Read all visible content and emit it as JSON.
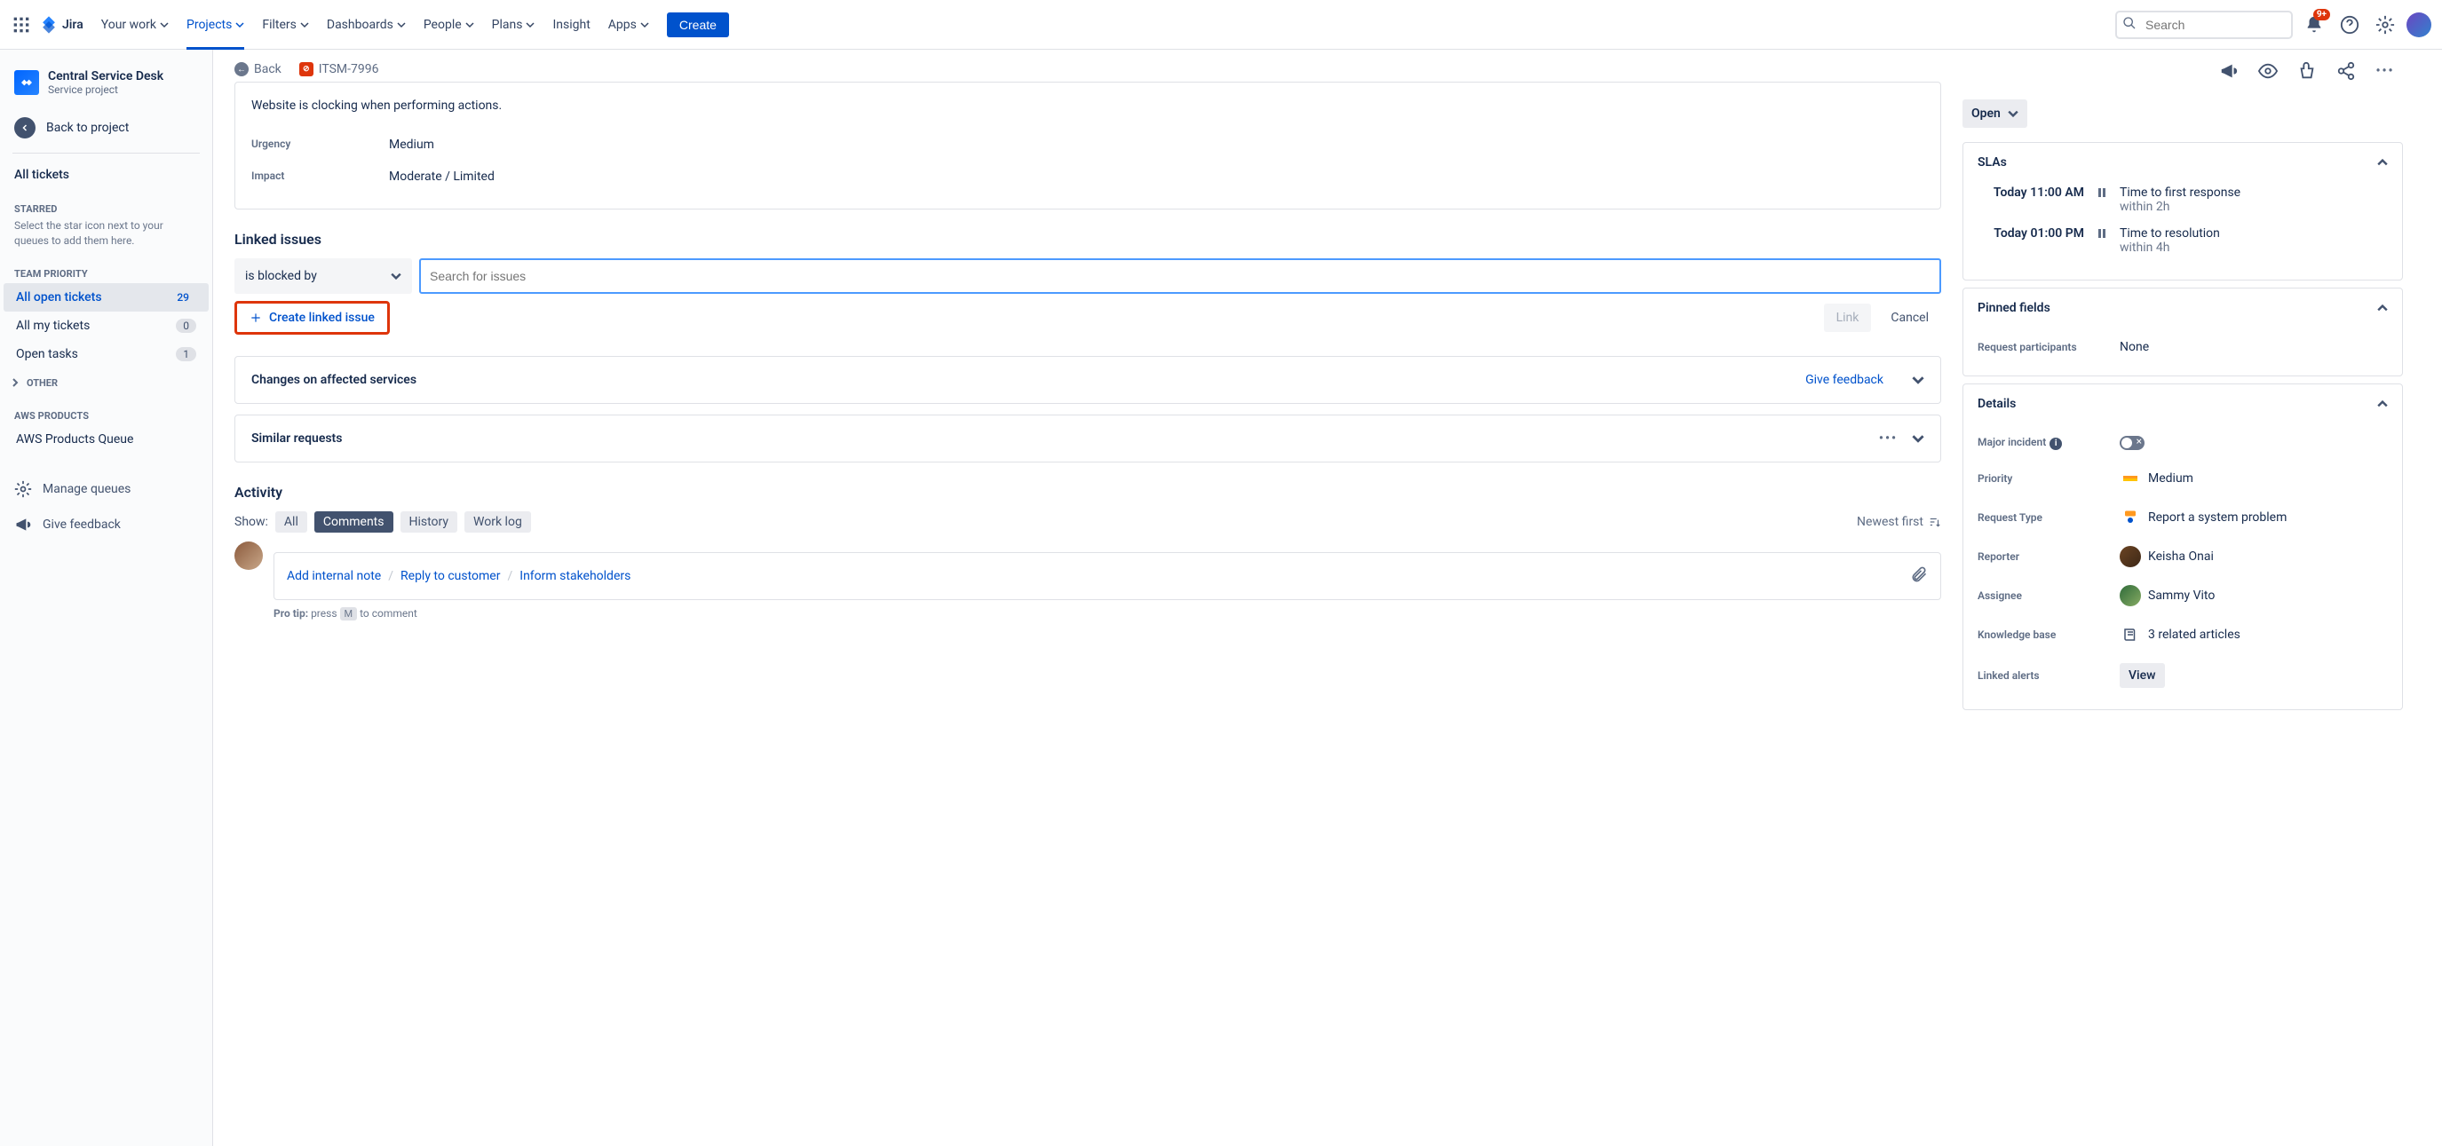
{
  "nav": {
    "brand": "Jira",
    "items": [
      "Your work",
      "Projects",
      "Filters",
      "Dashboards",
      "People",
      "Plans",
      "Insight",
      "Apps"
    ],
    "create": "Create",
    "searchPlaceholder": "Search",
    "notifBadge": "9+"
  },
  "sidebar": {
    "projectName": "Central Service Desk",
    "projectType": "Service project",
    "backToProject": "Back to project",
    "allTickets": "All tickets",
    "starredLabel": "STARRED",
    "starredDesc": "Select the star icon next to your queues to add them here.",
    "teamPriorityLabel": "TEAM PRIORITY",
    "queues": [
      {
        "name": "All open tickets",
        "count": "29"
      },
      {
        "name": "All my tickets",
        "count": "0"
      },
      {
        "name": "Open tasks",
        "count": "1"
      }
    ],
    "otherLabel": "OTHER",
    "awsLabel": "AWS PRODUCTS",
    "awsQueue": "AWS Products Queue",
    "manageQueues": "Manage queues",
    "giveFeedback": "Give feedback"
  },
  "breadcrumb": {
    "back": "Back",
    "issueKey": "ITSM-7996"
  },
  "mainPanel": {
    "description": "Website is clocking when performing actions.",
    "urgencyLabel": "Urgency",
    "urgencyValue": "Medium",
    "impactLabel": "Impact",
    "impactValue": "Moderate / Limited"
  },
  "linked": {
    "title": "Linked issues",
    "typeSelected": "is blocked by",
    "searchPlaceholder": "Search for issues",
    "createLinked": "Create linked issue",
    "linkBtn": "Link",
    "cancelBtn": "Cancel"
  },
  "changesPanel": {
    "title": "Changes on affected services",
    "feedback": "Give feedback"
  },
  "similarPanel": {
    "title": "Similar requests"
  },
  "activity": {
    "title": "Activity",
    "showLabel": "Show:",
    "tabs": [
      "All",
      "Comments",
      "History",
      "Work log"
    ],
    "newestFirst": "Newest first",
    "addNote": "Add internal note",
    "reply": "Reply to customer",
    "inform": "Inform stakeholders",
    "proTipLabel": "Pro tip:",
    "proTipPress": "press",
    "proTipKey": "M",
    "proTipRest": "to comment"
  },
  "status": "Open",
  "slas": {
    "title": "SLAs",
    "rows": [
      {
        "time": "Today 11:00 AM",
        "name": "Time to first response",
        "due": "within 2h"
      },
      {
        "time": "Today 01:00 PM",
        "name": "Time to resolution",
        "due": "within 4h"
      }
    ]
  },
  "pinned": {
    "title": "Pinned fields",
    "reqPartLabel": "Request participants",
    "reqPartValue": "None"
  },
  "details": {
    "title": "Details",
    "majorIncidentLabel": "Major incident",
    "priorityLabel": "Priority",
    "priorityValue": "Medium",
    "requestTypeLabel": "Request Type",
    "requestTypeValue": "Report a system problem",
    "reporterLabel": "Reporter",
    "reporterValue": "Keisha Onai",
    "assigneeLabel": "Assignee",
    "assigneeValue": "Sammy Vito",
    "kbLabel": "Knowledge base",
    "kbValue": "3 related articles",
    "alertsLabel": "Linked alerts",
    "viewBtn": "View"
  }
}
